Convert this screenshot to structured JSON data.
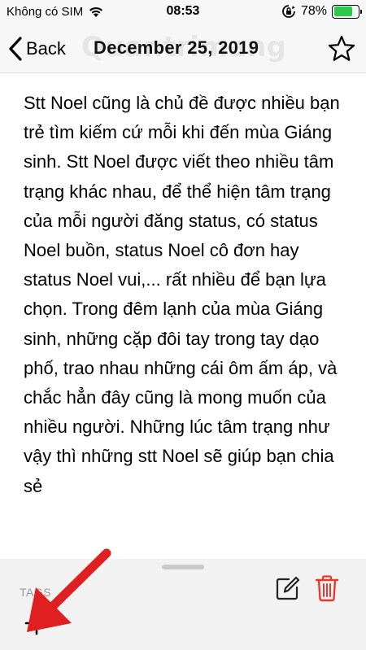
{
  "status_bar": {
    "carrier": "Không có SIM",
    "time": "08:53",
    "battery": "78%",
    "battery_level": 0.78
  },
  "nav": {
    "back_label": "Back",
    "title": "December 25, 2019",
    "watermark": "Quantrimang"
  },
  "content": {
    "text": "Stt Noel cũng là chủ đề được nhiều bạn trẻ tìm kiếm cứ mỗi khi đến mùa Giáng sinh. Stt Noel được viết theo nhiều tâm trạng khác nhau, để thể hiện tâm trạng của mỗi người đăng status, có status Noel buồn, status Noel cô đơn hay status Noel vui,... rất nhiều để bạn lựa chọn. Trong đêm lạnh của mùa Giáng sinh, những cặp đôi tay trong tay dạo phố, trao nhau những cái ôm ấm áp, và chắc hẳn đây cũng là mong muốn của nhiều người. Những lúc tâm trạng như vậy thì những stt Noel sẽ giúp bạn chia sẻ"
  },
  "sheet": {
    "tags_label": "TAGS"
  },
  "colors": {
    "accent_red": "#e8392f",
    "annotation_red": "#e02020",
    "battery_green": "#2ec94a"
  }
}
